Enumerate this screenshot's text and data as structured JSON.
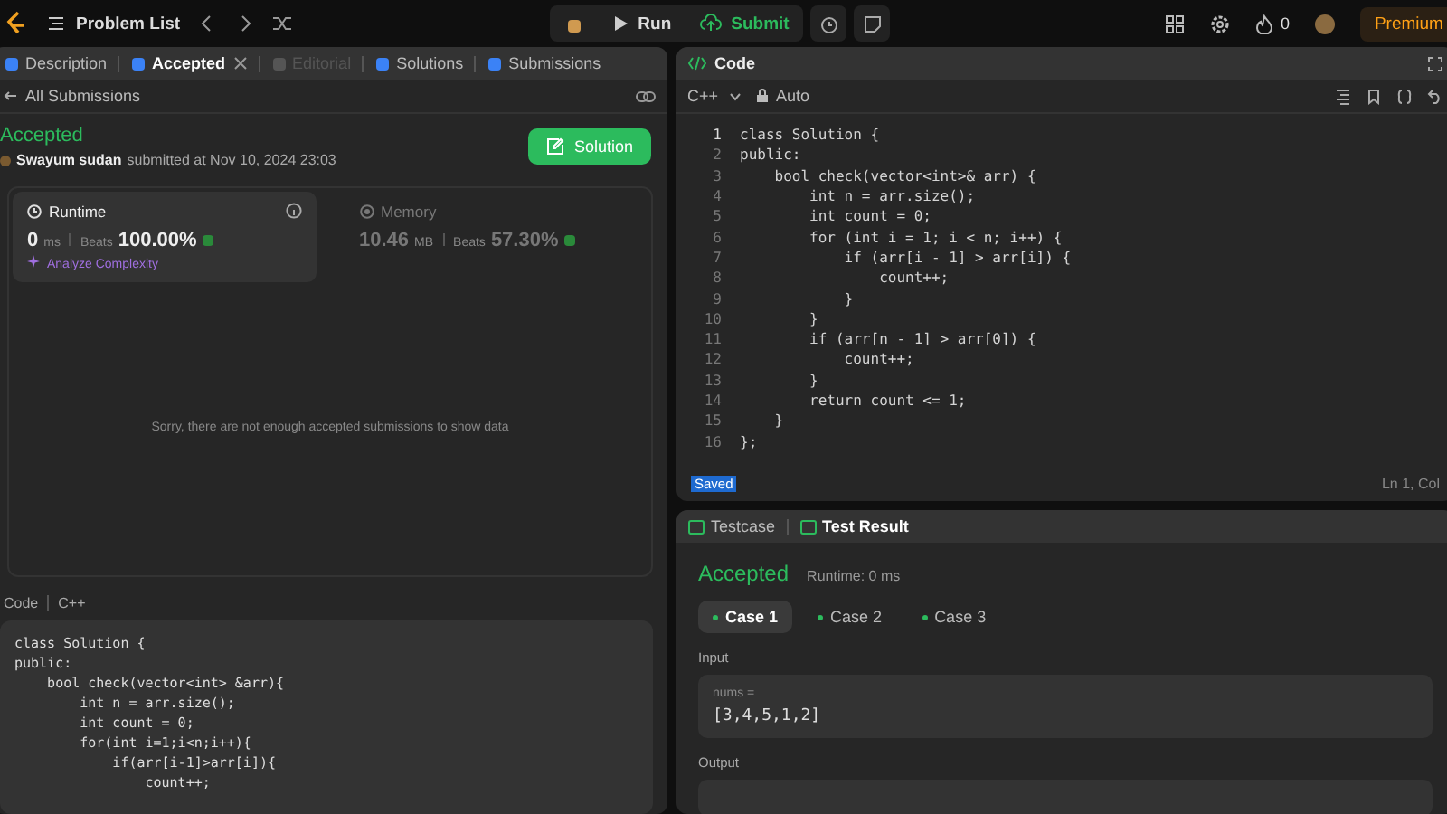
{
  "top_bar": {
    "problem_list": "Problem List",
    "run": "Run",
    "submit": "Submit",
    "streak": "0",
    "premium": "Premium"
  },
  "left_tabs": [
    {
      "label": "Description",
      "selected": false,
      "disabled": false,
      "closable": false
    },
    {
      "label": "Accepted",
      "selected": true,
      "disabled": false,
      "closable": true
    },
    {
      "label": "Editorial",
      "selected": false,
      "disabled": true,
      "closable": false
    },
    {
      "label": "Solutions",
      "selected": false,
      "disabled": false,
      "closable": false
    },
    {
      "label": "Submissions",
      "selected": false,
      "disabled": false,
      "closable": false
    }
  ],
  "submission": {
    "back": "All Submissions",
    "status": "Accepted",
    "user": "Swayum sudan",
    "submitted": "submitted at Nov 10, 2024 23:03",
    "solution_button": "Solution",
    "runtime": {
      "title": "Runtime",
      "value": "0",
      "unit": "ms",
      "beats_label": "Beats",
      "beats": "100.00%",
      "analyze": "Analyze Complexity",
      "selected": true
    },
    "memory": {
      "title": "Memory",
      "value": "10.46",
      "unit": "MB",
      "beats_label": "Beats",
      "beats": "57.30%",
      "selected": false
    },
    "empty_message": "Sorry, there are not enough accepted submissions to show data",
    "code_label": "Code",
    "language": "C++",
    "code": [
      "class Solution {",
      "public:",
      "    bool check(vector<int> &arr){",
      "        int n = arr.size();",
      "        int count = 0;",
      "        for(int i=1;i<n;i++){",
      "            if(arr[i-1]>arr[i]){",
      "                count++;"
    ]
  },
  "editor": {
    "title": "Code",
    "language": "C++",
    "mode": "Auto",
    "saved": "Saved",
    "cursor": "Ln 1, Col",
    "lines": [
      {
        "number": "1",
        "text": "class Solution {"
      },
      {
        "number": "2",
        "text": "public:"
      },
      {
        "number": "3",
        "text": "    bool check(vector<int>& arr) {"
      },
      {
        "number": "4",
        "text": "        int n = arr.size();"
      },
      {
        "number": "5",
        "text": "        int count = 0;"
      },
      {
        "number": "6",
        "text": "        for (int i = 1; i < n; i++) {"
      },
      {
        "number": "7",
        "text": "            if (arr[i - 1] > arr[i]) {"
      },
      {
        "number": "8",
        "text": "                count++;"
      },
      {
        "number": "9",
        "text": "            }"
      },
      {
        "number": "10",
        "text": "        }"
      },
      {
        "number": "11",
        "text": "        if (arr[n - 1] > arr[0]) {"
      },
      {
        "number": "12",
        "text": "            count++;"
      },
      {
        "number": "13",
        "text": "        }"
      },
      {
        "number": "14",
        "text": "        return count <= 1;"
      },
      {
        "number": "15",
        "text": "    }"
      },
      {
        "number": "16",
        "text": "};"
      }
    ]
  },
  "result_tabs": [
    {
      "label": "Testcase",
      "selected": false
    },
    {
      "label": "Test Result",
      "selected": true
    }
  ],
  "result": {
    "status": "Accepted",
    "runtime": "Runtime: 0 ms",
    "cases": [
      {
        "label": "Case 1",
        "selected": true
      },
      {
        "label": "Case 2",
        "selected": false
      },
      {
        "label": "Case 3",
        "selected": false
      }
    ],
    "input_label": "Input",
    "param": "nums =",
    "input_value": "[3,4,5,1,2]",
    "output_label": "Output"
  }
}
